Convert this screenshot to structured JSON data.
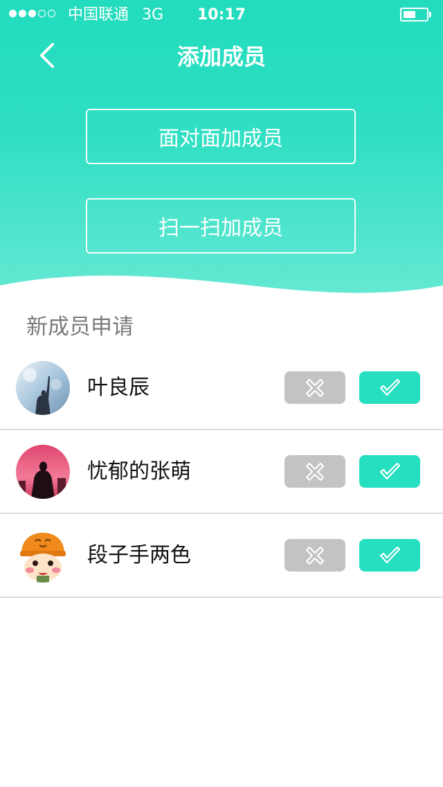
{
  "colors": {
    "accent": "#26dfc0",
    "header_top": "#24ddbf",
    "header_bottom": "#5ce6d1",
    "reject_bg": "#c3c3c3",
    "section_text": "#7a7a7a"
  },
  "status_bar": {
    "carrier": "中国联通",
    "network": "3G",
    "time": "10:17",
    "signal_bars_filled": 3,
    "signal_bars_total": 5,
    "battery_level": 0.5
  },
  "nav": {
    "back_icon": "chevron-left-icon",
    "title": "添加成员"
  },
  "actions": {
    "face_to_face": "面对面加成员",
    "scan": "扫一扫加成员"
  },
  "section": {
    "title": "新成员申请"
  },
  "requests": [
    {
      "name": "叶良辰",
      "avatar": "silhouette-sky-avatar",
      "reject_icon": "close-icon",
      "accept_icon": "check-icon"
    },
    {
      "name": "忧郁的张萌",
      "avatar": "silhouette-sunset-avatar",
      "reject_icon": "close-icon",
      "accept_icon": "check-icon"
    },
    {
      "name": "段子手两色",
      "avatar": "cartoon-helmet-avatar",
      "reject_icon": "close-icon",
      "accept_icon": "check-icon"
    }
  ]
}
